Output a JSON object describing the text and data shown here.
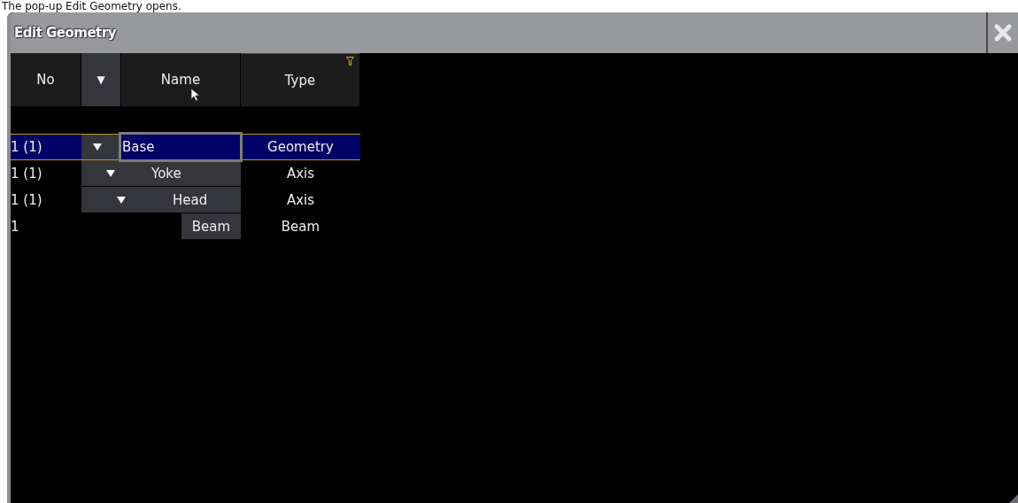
{
  "caption": "The pop-up Edit Geometry opens.",
  "window": {
    "title": "Edit Geometry"
  },
  "table": {
    "columns": [
      {
        "kind": "text",
        "label": "No",
        "filter": false
      },
      {
        "kind": "toggle",
        "label": "▼",
        "filter": false
      },
      {
        "kind": "text",
        "label": "Name",
        "filter": false
      },
      {
        "kind": "text",
        "label": "Type",
        "filter": true
      }
    ],
    "rows": [
      {
        "no": "1 (1)",
        "name": "Base",
        "type": "Geometry",
        "expanded": true,
        "selected": true,
        "children": [
          {
            "no": "1 (1)",
            "name": "Yoke",
            "type": "Axis",
            "expanded": true,
            "selected": false,
            "children": [
              {
                "no": "1 (1)",
                "name": "Head",
                "type": "Axis",
                "expanded": true,
                "selected": false,
                "children": [
                  {
                    "no": "1",
                    "name": "Beam",
                    "type": "Beam",
                    "selected": false
                  }
                ]
              }
            ]
          }
        ]
      }
    ]
  }
}
